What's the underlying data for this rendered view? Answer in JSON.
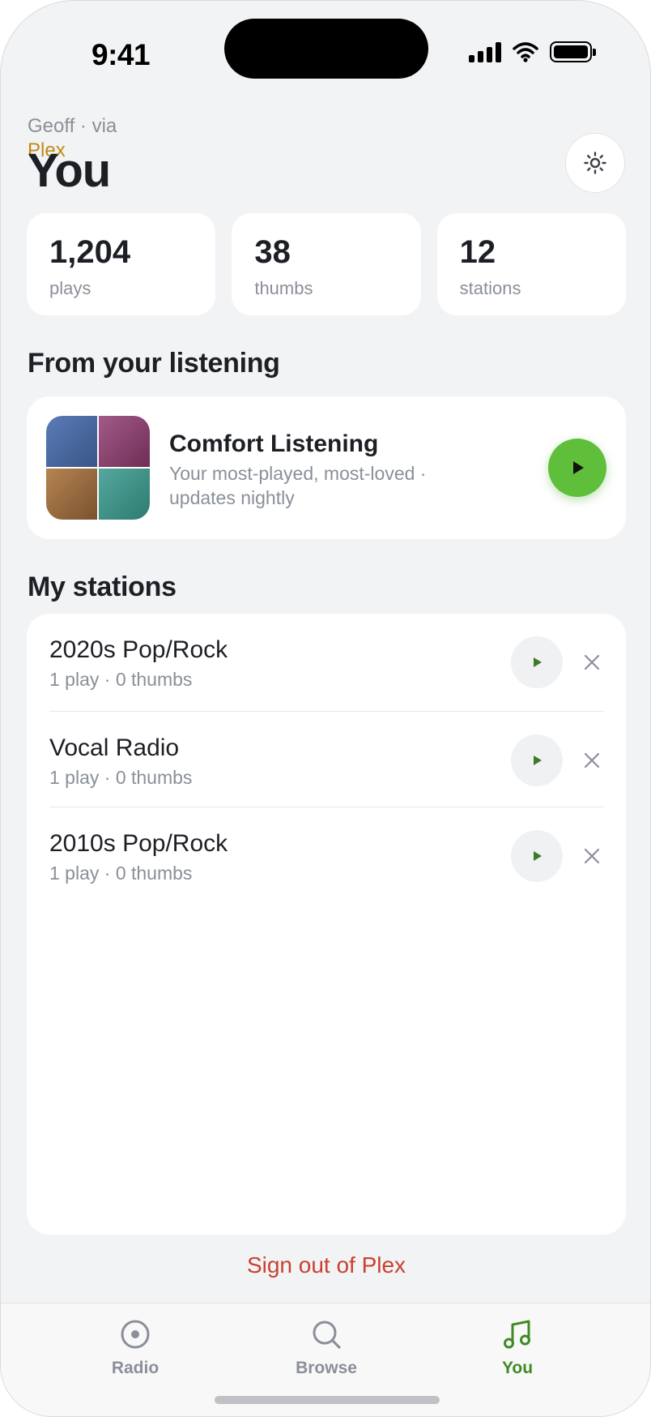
{
  "status_bar": {
    "time": "9:41"
  },
  "header": {
    "subtitle": "Geoff · via",
    "source": "Plex",
    "title": "You",
    "settings_icon": "gear-icon"
  },
  "stats": [
    {
      "value": "1,204",
      "label": "plays"
    },
    {
      "value": "38",
      "label": "thumbs"
    },
    {
      "value": "12",
      "label": "stations"
    }
  ],
  "from_listening": {
    "section_title": "From your listening",
    "card": {
      "title": "Comfort Listening",
      "description": "Your most-played, most-loved · updates nightly",
      "mosaic_colors": [
        "#4a6aa0",
        "#8c3f6e",
        "#9a6a3e",
        "#3e9088"
      ]
    }
  },
  "stations": {
    "section_title": "My stations",
    "items": [
      {
        "name": "2020s Pop/Rock",
        "meta": "1 play · 0 thumbs"
      },
      {
        "name": "Vocal Radio",
        "meta": "1 play · 0 thumbs"
      },
      {
        "name": "2010s Pop/Rock",
        "meta": "1 play · 0 thumbs"
      }
    ]
  },
  "sign_out": "Sign out of Plex",
  "tabbar": {
    "tabs": [
      {
        "label": "Radio",
        "icon": "radio-icon",
        "active": false
      },
      {
        "label": "Browse",
        "icon": "search-icon",
        "active": false
      },
      {
        "label": "You",
        "icon": "music-note-icon",
        "active": true
      }
    ]
  },
  "colors": {
    "accent_green": "#5fbf3a",
    "active_tab": "#3f8a22",
    "plex_gold": "#c08a12",
    "danger": "#c9402f"
  }
}
